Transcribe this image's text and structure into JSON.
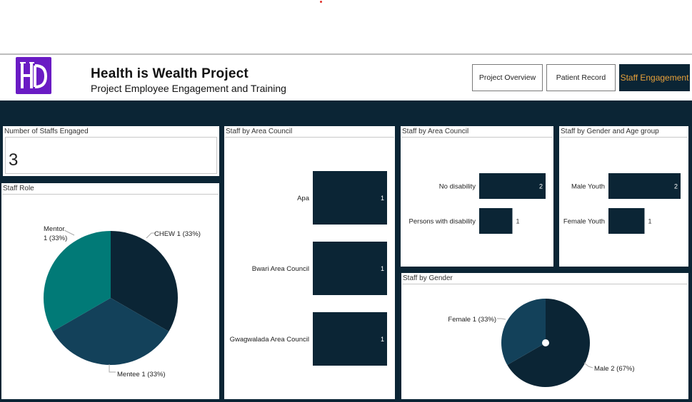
{
  "header": {
    "title": "Health is Wealth Project",
    "subtitle": "Project Employee Engagement and Training",
    "nav": [
      "Project Overview",
      "Patient Record",
      "Staff Engagement"
    ],
    "active_nav": "Staff Engagement",
    "logo_icon": "hw-monogram-logo"
  },
  "colors": {
    "navy": "#0b2535",
    "teal": "#017a77",
    "slate": "#13415a",
    "accent": "#e8a13a",
    "logo_bg": "#6a1bc4"
  },
  "kpi": {
    "title": "Number of Staffs Engaged",
    "value": "3"
  },
  "chart_data": [
    {
      "id": "staff_role",
      "type": "pie",
      "title": "Staff Role",
      "slices": [
        {
          "label": "CHEW",
          "value": 1,
          "percent": "33%",
          "data_label": "CHEW 1 (33%)",
          "color": "#0b2535"
        },
        {
          "label": "Mentee",
          "value": 1,
          "percent": "33%",
          "data_label": "Mentee 1 (33%)",
          "color": "#13415a"
        },
        {
          "label": "Mentor",
          "value": 1,
          "percent": "33%",
          "data_label_lines": [
            "Mentor",
            "1 (33%)"
          ],
          "color": "#017a77"
        }
      ]
    },
    {
      "id": "staff_by_area_council",
      "type": "bar",
      "orientation": "horizontal",
      "title": "Staff by Area Council",
      "categories": [
        "Apa",
        "Bwari Area Council",
        "Gwagwalada Area Council"
      ],
      "values": [
        1,
        1,
        1
      ],
      "labels": [
        "1",
        "1",
        "1"
      ],
      "xlim": [
        0,
        1
      ],
      "grid": false
    },
    {
      "id": "staff_by_disability",
      "type": "bar",
      "orientation": "horizontal",
      "title": "Staff by Area Council",
      "categories": [
        "No disability",
        "Persons with disability"
      ],
      "values": [
        2,
        1
      ],
      "labels": [
        "2",
        "1"
      ],
      "xlim": [
        0,
        2
      ],
      "grid": false
    },
    {
      "id": "staff_by_gender_age",
      "type": "bar",
      "orientation": "horizontal",
      "title": "Staff by Gender and Age group",
      "categories": [
        "Male Youth",
        "Female Youth"
      ],
      "values": [
        2,
        1
      ],
      "labels": [
        "2",
        "1"
      ],
      "xlim": [
        0,
        2
      ],
      "grid": false
    },
    {
      "id": "staff_by_gender",
      "type": "pie",
      "title": "Staff by Gender",
      "slices": [
        {
          "label": "Male",
          "value": 2,
          "percent": "67%",
          "data_label": "Male 2 (67%)",
          "color": "#0b2535"
        },
        {
          "label": "Female",
          "value": 1,
          "percent": "33%",
          "data_label": "Female 1 (33%)",
          "color": "#13415a"
        }
      ]
    }
  ]
}
